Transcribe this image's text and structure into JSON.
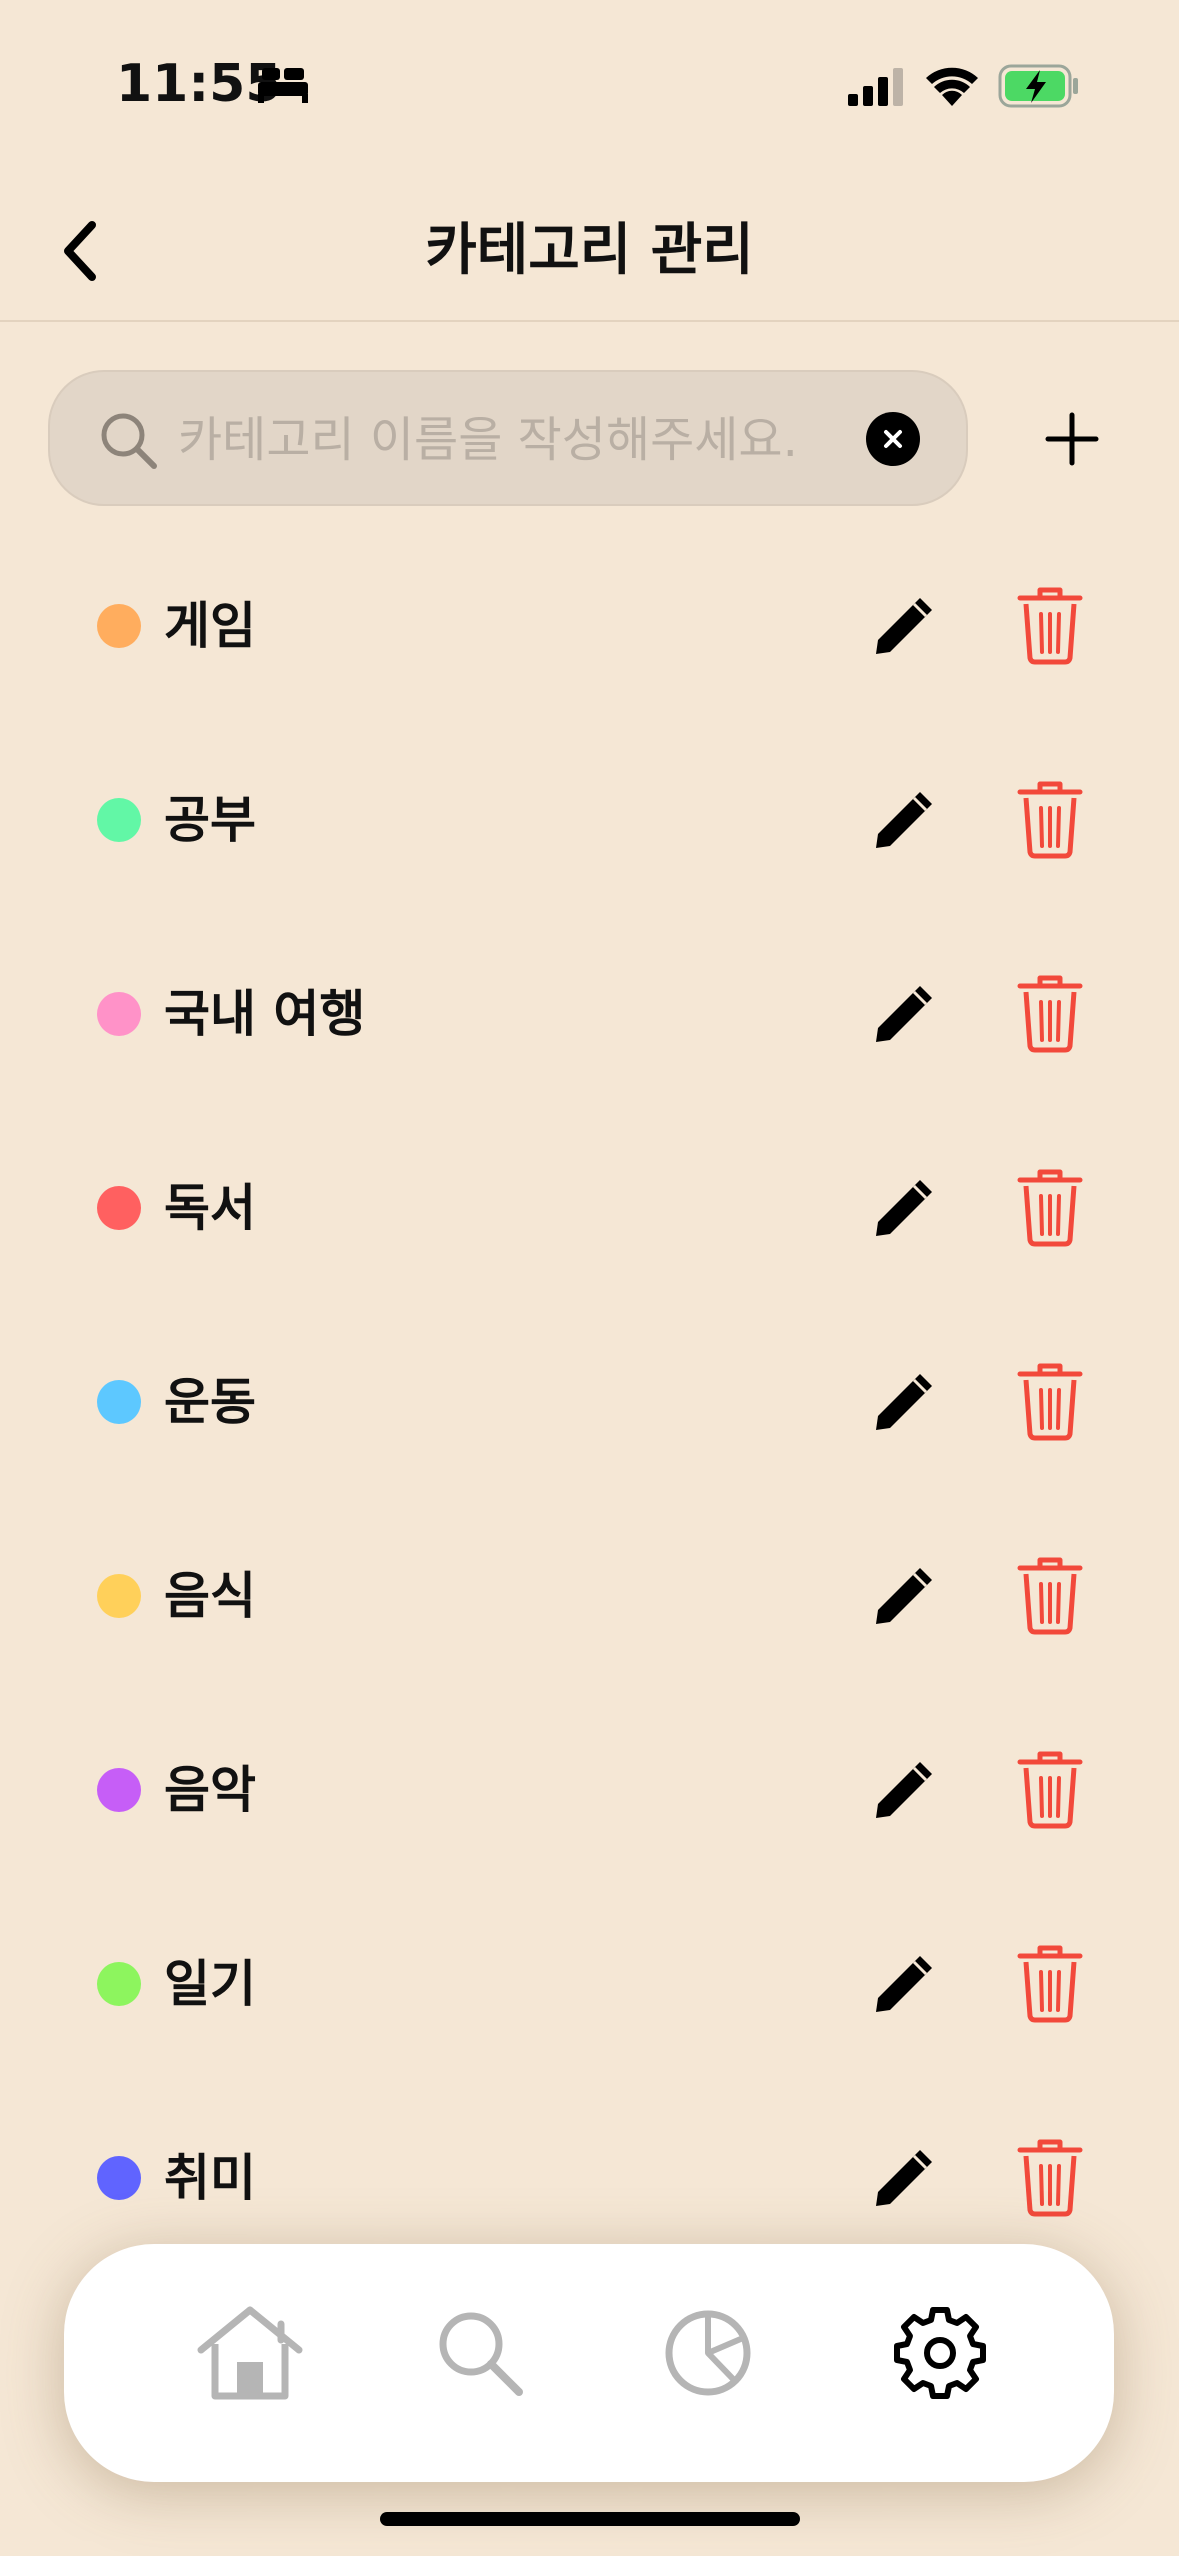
{
  "status_bar": {
    "time": "11:55",
    "icons": [
      "bed-icon",
      "cellular-signal-icon",
      "wifi-icon",
      "battery-charging-icon"
    ],
    "battery_color": "#4CD964"
  },
  "nav": {
    "title": "카테고리 관리",
    "back_icon": "chevron-left-icon"
  },
  "search": {
    "placeholder": "카테고리 이름을 작성해주세요.",
    "value": "",
    "icons": [
      "search-icon",
      "clear-icon",
      "plus-icon"
    ]
  },
  "categories": [
    {
      "label": "게임",
      "color": "#FFAD5E"
    },
    {
      "label": "공부",
      "color": "#62F7A6"
    },
    {
      "label": "국내 여행",
      "color": "#FF92C8"
    },
    {
      "label": "독서",
      "color": "#FF6060"
    },
    {
      "label": "운동",
      "color": "#5DC8FF"
    },
    {
      "label": "음식",
      "color": "#FFD05A"
    },
    {
      "label": "음악",
      "color": "#C65EF7"
    },
    {
      "label": "일기",
      "color": "#8DF55E"
    },
    {
      "label": "취미",
      "color": "#6064FF"
    }
  ],
  "row_actions": {
    "edit_icon": "pencil-icon",
    "delete_icon": "trash-icon",
    "delete_color": "#F2493B"
  },
  "tab_bar": {
    "tabs": [
      {
        "icon": "home-icon",
        "active": false
      },
      {
        "icon": "search-icon",
        "active": false
      },
      {
        "icon": "pie-chart-icon",
        "active": false
      },
      {
        "icon": "gear-icon",
        "active": true
      }
    ],
    "inactive_color": "#B5B5B5",
    "active_color": "#000000"
  }
}
